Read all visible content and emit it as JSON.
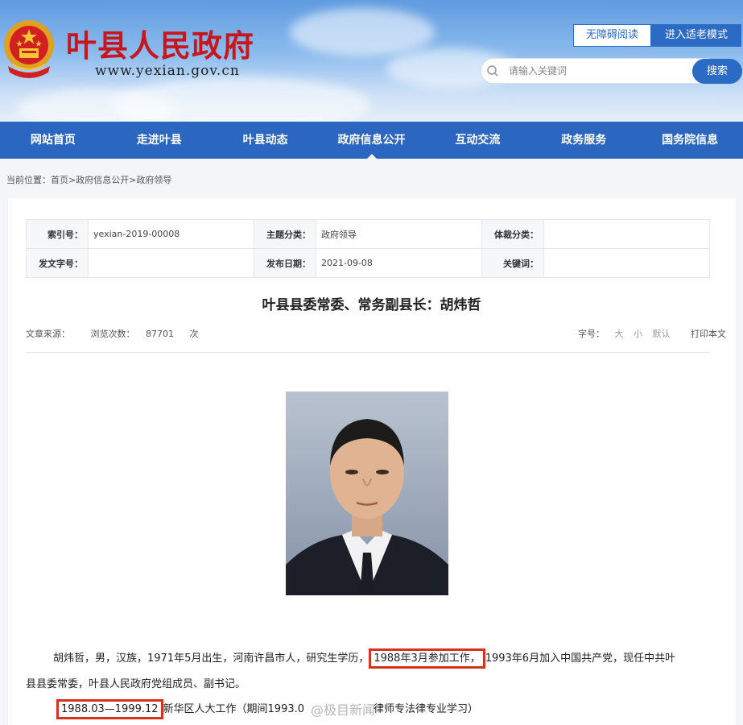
{
  "header": {
    "site_title": "叶县人民政府",
    "site_url": "www.yexian.gov.cn",
    "accessibility_label": "无障碍阅读",
    "elder_mode_label": "进入适老模式",
    "search_placeholder": "请输入关键词",
    "search_button": "搜索"
  },
  "nav": {
    "items": [
      "网站首页",
      "走进叶县",
      "叶县动态",
      "政府信息公开",
      "互动交流",
      "政务服务",
      "国务院信息"
    ],
    "active_index": 3
  },
  "breadcrumb": {
    "label": "当前位置：",
    "path": "首页>政府信息公开>政府领导"
  },
  "meta": {
    "index_label": "索引号：",
    "index_value": "yexian-2019-00008",
    "topic_label": "主题分类：",
    "topic_value": "政府领导",
    "genre_label": "体裁分类：",
    "genre_value": "",
    "doc_no_label": "发文字号：",
    "doc_no_value": "",
    "date_label": "发布日期：",
    "date_value": "2021-09-08",
    "keywords_label": "关键词：",
    "keywords_value": ""
  },
  "article": {
    "title": "叶县县委常委、常务副县长：胡炜哲",
    "source_label": "文章来源：",
    "views_label": "浏览次数：",
    "views_value": "87701",
    "views_unit": "次",
    "font_label": "字号：",
    "font_large": "大",
    "font_small": "小",
    "font_default": "默认",
    "print_label": "打印本文",
    "bio_p1_a": "胡炜哲，男，汉族，1971年5月出生，河南许昌市人，研究生学历，",
    "bio_p1_hl": "1988年3月参加工作，",
    "bio_p1_b": "1993年6月加入中国共产党，现任中共叶",
    "bio_p1_c": "县县委常委，叶县人民政府党组成员、副书记。",
    "bio_p2_hl": "1988.03—1999.12",
    "bio_p2_a": "新华区人大工作（期间1993.0",
    "bio_p2_b": "律师专法律专业学习）"
  },
  "watermark": "@极目新闻",
  "colors": {
    "nav_blue": "#2b67c1",
    "title_red": "#c8161d",
    "highlight_red": "#d6321f"
  }
}
